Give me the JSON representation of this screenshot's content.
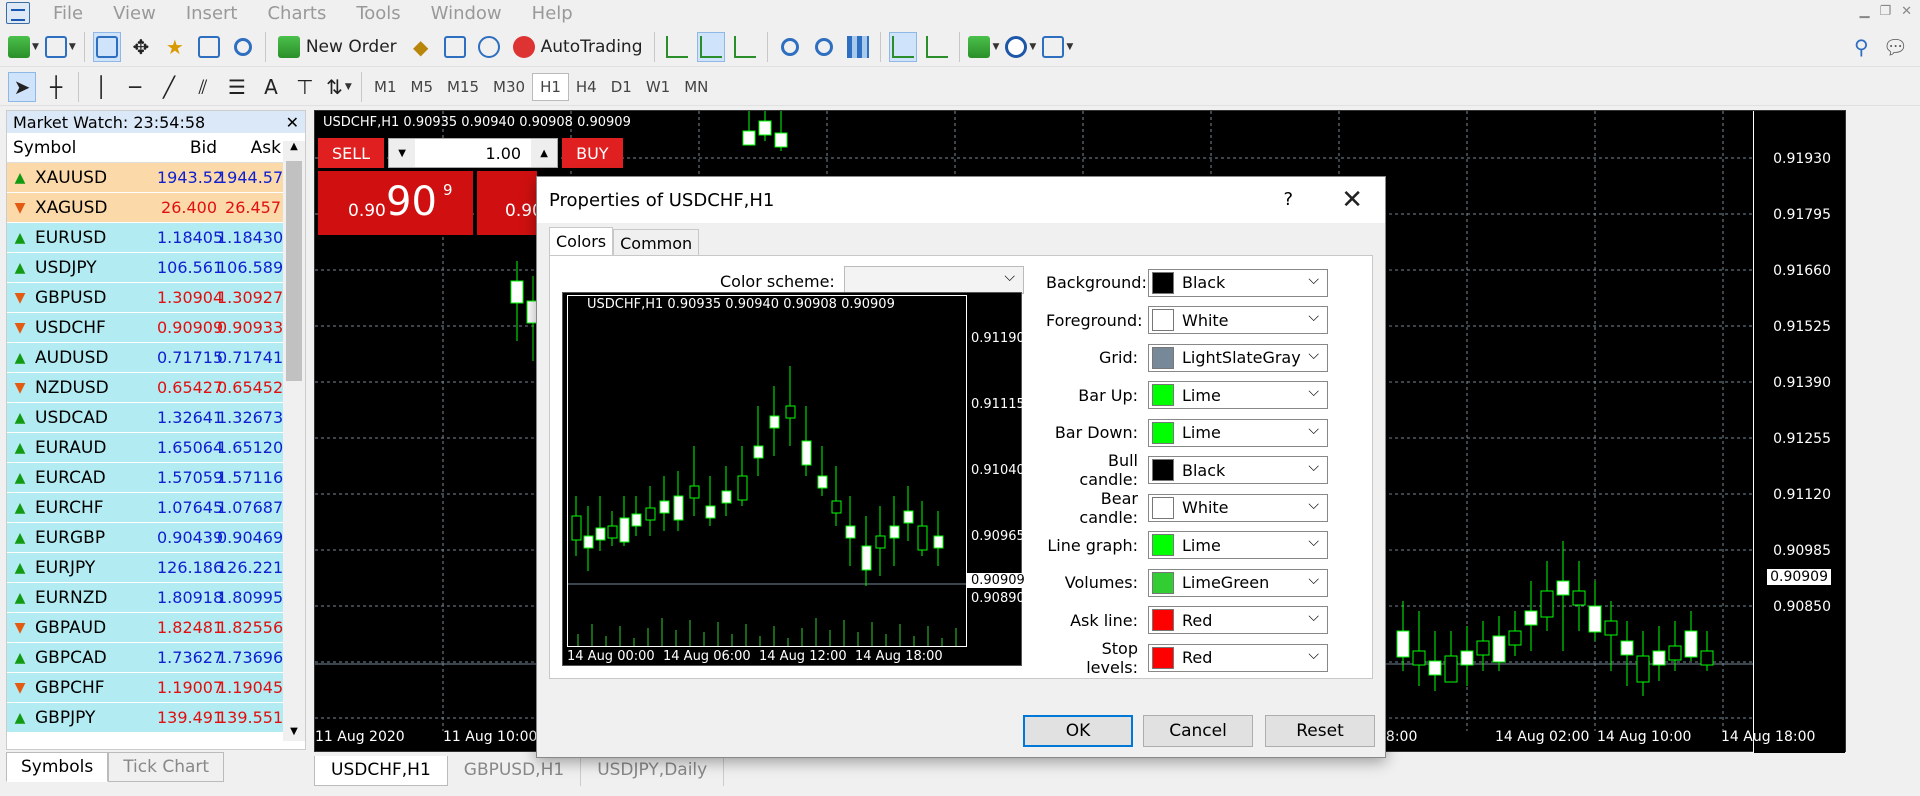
{
  "menu": [
    "File",
    "View",
    "Insert",
    "Charts",
    "Tools",
    "Window",
    "Help"
  ],
  "toolbar": {
    "new_order": "New Order",
    "autotrading": "AutoTrading"
  },
  "timeframes": [
    "M1",
    "M5",
    "M15",
    "M30",
    "H1",
    "H4",
    "D1",
    "W1",
    "MN"
  ],
  "timeframe_active": "H1",
  "market_watch": {
    "title": "Market Watch: 23:54:58",
    "headers": {
      "symbol": "Symbol",
      "bid": "Bid",
      "ask": "Ask"
    },
    "rows": [
      {
        "symbol": "XAUUSD",
        "bid": "1943.52",
        "ask": "1944.57",
        "dir": "up",
        "bg": "gold",
        "color": "blue"
      },
      {
        "symbol": "XAGUSD",
        "bid": "26.400",
        "ask": "26.457",
        "dir": "down",
        "bg": "gold",
        "color": "red"
      },
      {
        "symbol": "EURUSD",
        "bid": "1.18405",
        "ask": "1.18430",
        "dir": "up",
        "bg": "teal",
        "color": "blue"
      },
      {
        "symbol": "USDJPY",
        "bid": "106.561",
        "ask": "106.589",
        "dir": "up",
        "bg": "teal",
        "color": "blue"
      },
      {
        "symbol": "GBPUSD",
        "bid": "1.30904",
        "ask": "1.30927",
        "dir": "down",
        "bg": "teal",
        "color": "red"
      },
      {
        "symbol": "USDCHF",
        "bid": "0.90909",
        "ask": "0.90933",
        "dir": "down",
        "bg": "teal",
        "color": "red"
      },
      {
        "symbol": "AUDUSD",
        "bid": "0.71715",
        "ask": "0.71741",
        "dir": "up",
        "bg": "teal",
        "color": "blue"
      },
      {
        "symbol": "NZDUSD",
        "bid": "0.65427",
        "ask": "0.65452",
        "dir": "down",
        "bg": "teal",
        "color": "red"
      },
      {
        "symbol": "USDCAD",
        "bid": "1.32641",
        "ask": "1.32673",
        "dir": "up",
        "bg": "teal",
        "color": "blue"
      },
      {
        "symbol": "EURAUD",
        "bid": "1.65064",
        "ask": "1.65120",
        "dir": "up",
        "bg": "teal",
        "color": "blue"
      },
      {
        "symbol": "EURCAD",
        "bid": "1.57059",
        "ask": "1.57116",
        "dir": "up",
        "bg": "teal",
        "color": "blue"
      },
      {
        "symbol": "EURCHF",
        "bid": "1.07645",
        "ask": "1.07687",
        "dir": "up",
        "bg": "teal",
        "color": "blue"
      },
      {
        "symbol": "EURGBP",
        "bid": "0.90439",
        "ask": "0.90469",
        "dir": "up",
        "bg": "teal",
        "color": "blue"
      },
      {
        "symbol": "EURJPY",
        "bid": "126.186",
        "ask": "126.221",
        "dir": "up",
        "bg": "teal",
        "color": "blue"
      },
      {
        "symbol": "EURNZD",
        "bid": "1.80918",
        "ask": "1.80995",
        "dir": "up",
        "bg": "teal",
        "color": "blue"
      },
      {
        "symbol": "GBPAUD",
        "bid": "1.82481",
        "ask": "1.82556",
        "dir": "down",
        "bg": "teal",
        "color": "red"
      },
      {
        "symbol": "GBPCAD",
        "bid": "1.73627",
        "ask": "1.73696",
        "dir": "up",
        "bg": "teal",
        "color": "blue"
      },
      {
        "symbol": "GBPCHF",
        "bid": "1.19007",
        "ask": "1.19045",
        "dir": "down",
        "bg": "teal",
        "color": "red"
      },
      {
        "symbol": "GBPJPY",
        "bid": "139.491",
        "ask": "139.551",
        "dir": "up",
        "bg": "teal",
        "color": "red"
      }
    ],
    "tabs": [
      "Symbols",
      "Tick Chart"
    ]
  },
  "chart": {
    "title": "USDCHF,H1  0.90935 0.90940 0.90908 0.90909",
    "sell": "SELL",
    "buy": "BUY",
    "lot": "1.00",
    "price_small": "0.90",
    "price_big": "90",
    "price_sup": "9",
    "price_small2": "0.90",
    "prices": [
      "0.91930",
      "0.91795",
      "0.91660",
      "0.91525",
      "0.91390",
      "0.91255",
      "0.91120",
      "0.90985",
      "0.90909",
      "0.90850"
    ],
    "current_price": "0.90909",
    "times": [
      "11 Aug 2020",
      "11 Aug 10:00",
      "18:00",
      "14 Aug 02:00",
      "14 Aug 10:00",
      "14 Aug 18:00"
    ]
  },
  "chart_tabs": [
    "USDCHF,H1",
    "GBPUSD,H1",
    "USDJPY,Daily"
  ],
  "dialog": {
    "title": "Properties of USDCHF,H1",
    "help": "?",
    "tabs": [
      "Colors",
      "Common"
    ],
    "color_scheme_label": "Color scheme:",
    "preview": {
      "title": "USDCHF,H1  0.90935 0.90940 0.90908 0.90909",
      "prices": [
        "0.91190",
        "0.91115",
        "0.91040",
        "0.90965",
        "0.90909",
        "0.90890"
      ],
      "times": [
        "14 Aug 00:00",
        "14 Aug 06:00",
        "14 Aug 12:00",
        "14 Aug 18:00"
      ]
    },
    "properties": [
      {
        "label": "Background:",
        "value": "Black",
        "swatch": "#000000"
      },
      {
        "label": "Foreground:",
        "value": "White",
        "swatch": "#ffffff"
      },
      {
        "label": "Grid:",
        "value": "LightSlateGray",
        "swatch": "#778899"
      },
      {
        "label": "Bar Up:",
        "value": "Lime",
        "swatch": "#00ff00"
      },
      {
        "label": "Bar Down:",
        "value": "Lime",
        "swatch": "#00ff00"
      },
      {
        "label": "Bull candle:",
        "value": "Black",
        "swatch": "#000000"
      },
      {
        "label": "Bear candle:",
        "value": "White",
        "swatch": "#ffffff"
      },
      {
        "label": "Line graph:",
        "value": "Lime",
        "swatch": "#00ff00"
      },
      {
        "label": "Volumes:",
        "value": "LimeGreen",
        "swatch": "#32cd32"
      },
      {
        "label": "Ask line:",
        "value": "Red",
        "swatch": "#ff0000"
      },
      {
        "label": "Stop levels:",
        "value": "Red",
        "swatch": "#ff0000"
      }
    ],
    "buttons": {
      "ok": "OK",
      "cancel": "Cancel",
      "reset": "Reset"
    }
  }
}
